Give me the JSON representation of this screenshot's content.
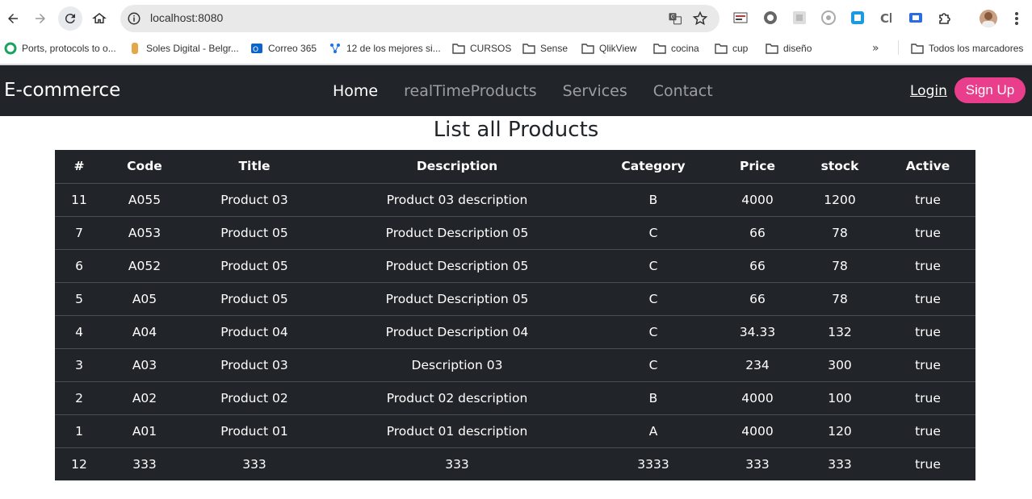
{
  "browser": {
    "url": "localhost:8080",
    "bookmarks": [
      {
        "label": "Ports, protocols to o...",
        "icon": "green-q-icon"
      },
      {
        "label": "Soles Digital - Belgr...",
        "icon": "soles-icon"
      },
      {
        "label": "Correo 365",
        "icon": "outlook-icon"
      },
      {
        "label": "12 de los mejores si...",
        "icon": "tree-icon"
      },
      {
        "label": "CURSOS",
        "icon": "folder-icon"
      },
      {
        "label": "Sense",
        "icon": "folder-icon"
      },
      {
        "label": "QlikView",
        "icon": "folder-icon"
      },
      {
        "label": "cocina",
        "icon": "folder-icon"
      },
      {
        "label": "cup",
        "icon": "folder-icon"
      },
      {
        "label": "diseño",
        "icon": "folder-icon"
      }
    ],
    "all_bookmarks": "Todos los marcadores"
  },
  "navbar": {
    "brand": "E-commerce",
    "links": [
      {
        "label": "Home",
        "active": true
      },
      {
        "label": "realTimeProducts",
        "active": false
      },
      {
        "label": "Services",
        "active": false
      },
      {
        "label": "Contact",
        "active": false
      }
    ],
    "login": "Login",
    "signup": "Sign Up",
    "signup_color": "#e83e8c",
    "bar_color": "#212529"
  },
  "main": {
    "title": "List all Products",
    "columns": [
      "#",
      "Code",
      "Title",
      "Description",
      "Category",
      "Price",
      "stock",
      "Active"
    ],
    "rows": [
      [
        "11",
        "A055",
        "Product 03",
        "Product 03 description",
        "B",
        "4000",
        "1200",
        "true"
      ],
      [
        "7",
        "A053",
        "Product 05",
        "Product Description 05",
        "C",
        "66",
        "78",
        "true"
      ],
      [
        "6",
        "A052",
        "Product 05",
        "Product Description 05",
        "C",
        "66",
        "78",
        "true"
      ],
      [
        "5",
        "A05",
        "Product 05",
        "Product Description 05",
        "C",
        "66",
        "78",
        "true"
      ],
      [
        "4",
        "A04",
        "Product 04",
        "Product Description 04",
        "C",
        "34.33",
        "132",
        "true"
      ],
      [
        "3",
        "A03",
        "Product 03",
        "Description 03",
        "C",
        "234",
        "300",
        "true"
      ],
      [
        "2",
        "A02",
        "Product 02",
        "Product 02 description",
        "B",
        "4000",
        "100",
        "true"
      ],
      [
        "1",
        "A01",
        "Product 01",
        "Product 01 description",
        "A",
        "4000",
        "120",
        "true"
      ],
      [
        "12",
        "333",
        "333",
        "333",
        "3333",
        "333",
        "333",
        "true"
      ]
    ]
  }
}
